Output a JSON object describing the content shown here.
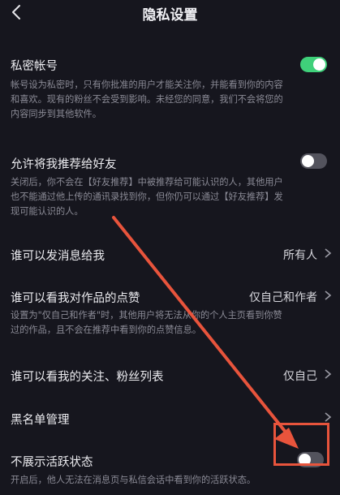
{
  "header": {
    "title": "隐私设置"
  },
  "private_account": {
    "title": "私密帐号",
    "desc_lines": [
      "帐号设为私密时，只有你批准的用户才能关注你，并能看到你的内容",
      "和喜欢。现有的粉丝不会受到影响。未经您的同意，我们不会将您的",
      "内容同步到其他软件。"
    ],
    "enabled": true
  },
  "recommend_friends": {
    "title": "允许将我推荐给好友",
    "desc_lines": [
      "关闭后，你不会在【好友推荐】中被推荐给可能认识的人，其他用户",
      "也不能通过他上传的通讯录找到你，但你仍可以通过【好友推荐】发",
      "现可能认识的人。"
    ],
    "enabled": false
  },
  "who_can_message": {
    "title": "谁可以发消息给我",
    "value": "所有人"
  },
  "who_can_see_likes": {
    "title": "谁可以看我对作品的点赞",
    "value": "仅自己和作者",
    "desc_lines": [
      "设置为\"仅自己和作者\"时，其他用户将无法从你的个人主页看到你赞",
      "过的作品，且不会在推荐中看到你的点赞信息。"
    ]
  },
  "who_can_see_follows": {
    "title": "谁可以看我的关注、粉丝列表",
    "value": "仅自己"
  },
  "blacklist": {
    "title": "黑名单管理"
  },
  "hide_activity": {
    "title": "不展示活跃状态",
    "desc_lines": [
      "开启后，他人无法在消息页与私信会话中看到你的活跃状态。"
    ],
    "enabled": false
  },
  "colors": {
    "background": "#16161e",
    "toggle_on": "#3fd07a",
    "toggle_off": "#53535d",
    "annotation": "#e8543c"
  }
}
